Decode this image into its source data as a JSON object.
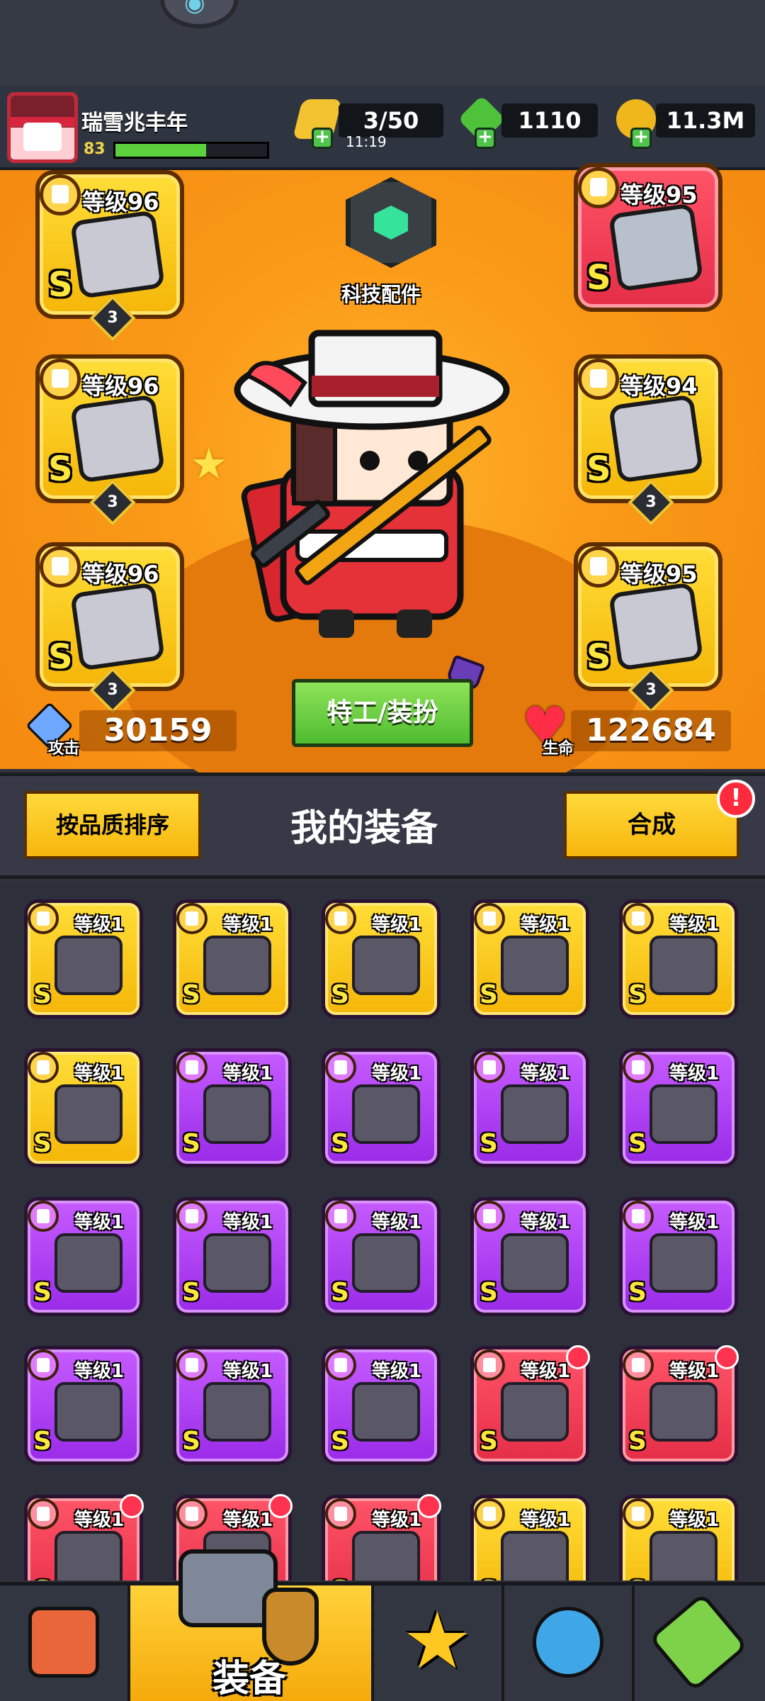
{
  "player": {
    "name": "瑞雪兆丰年",
    "level": "83",
    "xp_fraction": 0.6
  },
  "resources": {
    "energy": "3/50",
    "energy_timer": "11:19",
    "gems": "1110",
    "coins": "11.3M"
  },
  "hero": {
    "tech_label": "科技配件",
    "agent_button": "特工/装扮",
    "attack_label": "攻击",
    "attack_value": "30159",
    "hp_label": "生命",
    "hp_value": "122684"
  },
  "equipped": [
    {
      "level": "等级96",
      "grade": "S",
      "stars": "3",
      "rarity": "gold",
      "kind": "sword-icon"
    },
    {
      "level": "等级95",
      "grade": "S",
      "stars": "",
      "rarity": "red",
      "kind": "armor-icon"
    },
    {
      "level": "等级96",
      "grade": "S",
      "stars": "3",
      "rarity": "gold",
      "kind": "ring-icon"
    },
    {
      "level": "等级94",
      "grade": "S",
      "stars": "3",
      "rarity": "gold",
      "kind": "belt-icon"
    },
    {
      "level": "等级96",
      "grade": "S",
      "stars": "3",
      "rarity": "gold",
      "kind": "glove-icon"
    },
    {
      "level": "等级95",
      "grade": "S",
      "stars": "3",
      "rarity": "gold",
      "kind": "boot-icon"
    }
  ],
  "inventory_header": {
    "sort_button": "按品质排序",
    "title": "我的装备",
    "merge_button": "合成",
    "alert_badge": "!"
  },
  "inventory": [
    {
      "level": "等级1",
      "rarity": "gold",
      "kind": "blaster-icon"
    },
    {
      "level": "等级1",
      "rarity": "gold",
      "kind": "armor-icon"
    },
    {
      "level": "等级1",
      "rarity": "gold",
      "kind": "necklace-icon"
    },
    {
      "level": "等级1",
      "rarity": "gold",
      "kind": "belt-icon"
    },
    {
      "level": "等级1",
      "rarity": "gold",
      "kind": "glove-icon"
    },
    {
      "level": "等级1",
      "rarity": "gold",
      "kind": "boot-icon"
    },
    {
      "level": "等级1",
      "rarity": "purple",
      "kind": "sword-icon"
    },
    {
      "level": "等级1",
      "rarity": "purple",
      "kind": "helmet-icon"
    },
    {
      "level": "等级1",
      "rarity": "purple",
      "kind": "armor-icon"
    },
    {
      "level": "等级1",
      "rarity": "purple",
      "kind": "armor-icon"
    },
    {
      "level": "等级1",
      "rarity": "purple",
      "kind": "armor-icon"
    },
    {
      "level": "等级1",
      "rarity": "purple",
      "kind": "ring-icon"
    },
    {
      "level": "等级1",
      "rarity": "purple",
      "kind": "ring-icon"
    },
    {
      "level": "等级1",
      "rarity": "purple",
      "kind": "belt-icon"
    },
    {
      "level": "等级1",
      "rarity": "purple",
      "kind": "belt-icon"
    },
    {
      "level": "等级1",
      "rarity": "purple",
      "kind": "glove-icon"
    },
    {
      "level": "等级1",
      "rarity": "purple",
      "kind": "boot-icon"
    },
    {
      "level": "等级1",
      "rarity": "purple",
      "kind": "boot-icon"
    },
    {
      "level": "等级1",
      "rarity": "red",
      "kind": "kunai-icon"
    },
    {
      "level": "等级1",
      "rarity": "red",
      "kind": "spiked-ring-icon"
    },
    {
      "level": "等级1",
      "rarity": "red",
      "kind": "belt-icon"
    },
    {
      "level": "等级1",
      "rarity": "red",
      "kind": "glove-icon"
    },
    {
      "level": "等级1",
      "rarity": "red",
      "kind": "boot-icon"
    },
    {
      "level": "等级1",
      "rarity": "gold",
      "kind": "armor-icon"
    },
    {
      "level": "等级1",
      "rarity": "gold",
      "kind": "necklace-icon"
    }
  ],
  "nav": {
    "active_label": "装备"
  }
}
